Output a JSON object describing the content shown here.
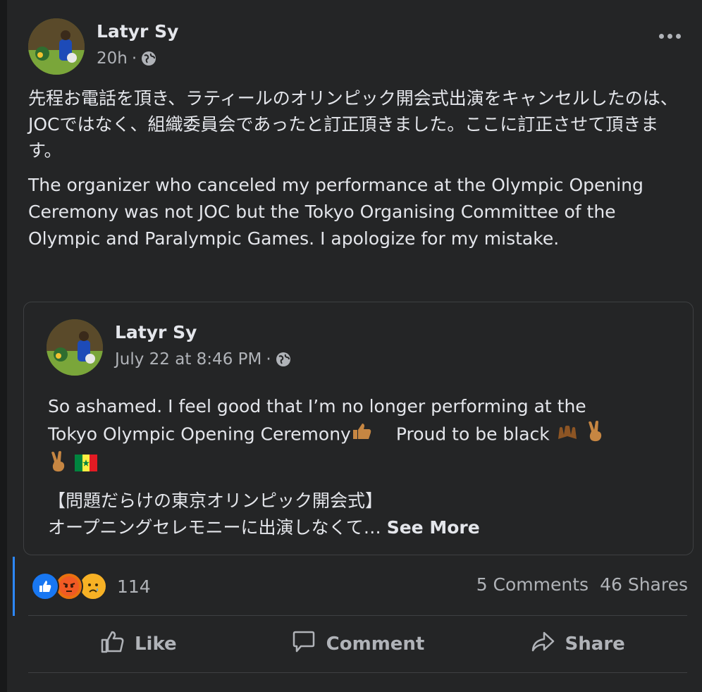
{
  "post": {
    "author": "Latyr Sy",
    "time": "20h",
    "separator": "·",
    "text_ja": "先程お電話を頂き、ラティールのオリンピック開会式出演をキャンセルしたのは、JOCではなく、組織委員会であったと訂正頂きました。ここに訂正させて頂きます。",
    "text_en": "The organizer who canceled my performance at the Olympic Opening Ceremony was not JOC but the Tokyo Organising Committee of the Olympic and Paralympic Games. I apologize for my mistake."
  },
  "shared": {
    "author": "Latyr Sy",
    "time": "July 22 at 8:46 PM",
    "separator": "·",
    "line1": "So ashamed. I feel good that I’m no longer performing at the",
    "line2a": "Tokyo Olympic Opening Ceremony",
    "line2b": "Proud to be black",
    "line3": "【問題だらけの東京オリンピック開会式】",
    "line4": "オープニングセレモニーに出演しなくて…",
    "see_more": "See More"
  },
  "engagement": {
    "reaction_count": "114",
    "comments": "5 Comments",
    "shares": "46 Shares"
  },
  "actions": {
    "like": "Like",
    "comment": "Comment",
    "share": "Share"
  },
  "icons": [
    "globe-icon",
    "more-options-icon",
    "like-reaction-icon",
    "angry-reaction-icon",
    "sad-reaction-icon",
    "thumbs-up-icon",
    "speech-bubble-icon",
    "share-arrow-icon"
  ],
  "colors": {
    "background": "#242526",
    "text": "#e4e6eb",
    "secondary": "#b0b3b8",
    "accent": "#2d88ff"
  }
}
